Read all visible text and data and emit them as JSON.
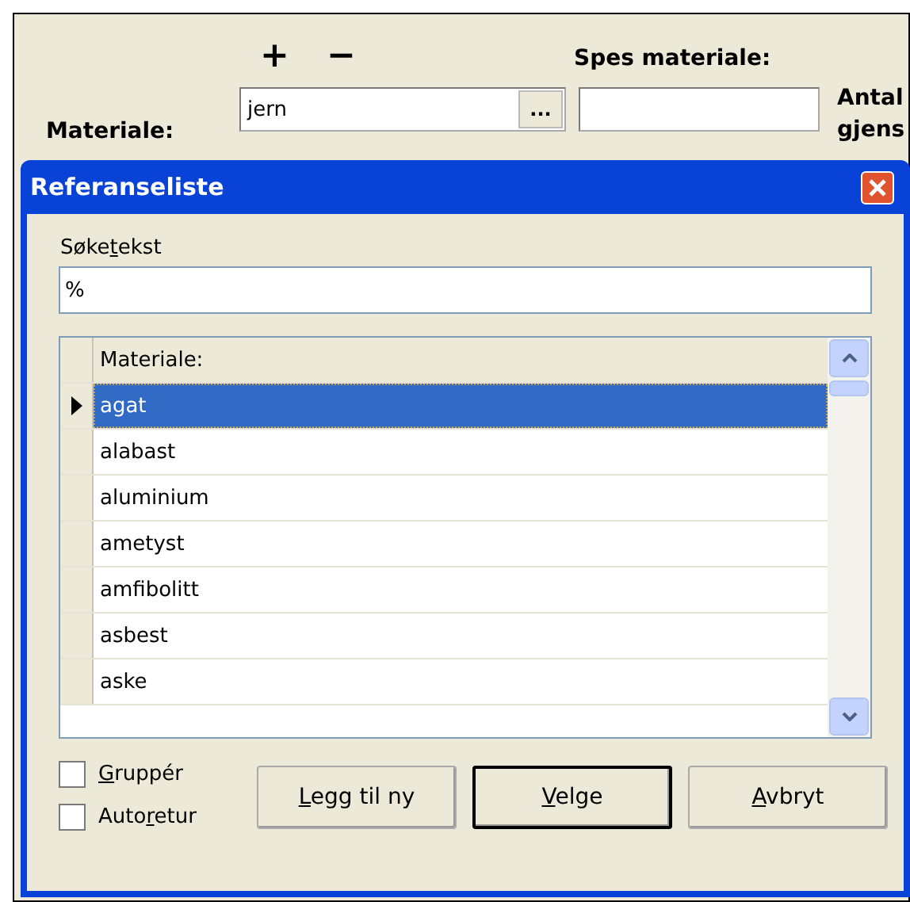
{
  "main_form": {
    "add_symbol": "+",
    "remove_symbol": "−",
    "material_label": "Materiale:",
    "material_value": "jern",
    "browse_button": "...",
    "spec_label": "Spes materiale:",
    "cut_label_lines": [
      "Antal",
      "gjens"
    ]
  },
  "dialog": {
    "title": "Referanseliste",
    "search": {
      "label": {
        "before": "Søke",
        "key": "t",
        "after": "ekst"
      },
      "value": "%"
    },
    "grid": {
      "column": "Materiale:",
      "rows": [
        {
          "name": "agat",
          "selected": true
        },
        {
          "name": "alabast",
          "selected": false
        },
        {
          "name": "aluminium",
          "selected": false
        },
        {
          "name": "ametyst",
          "selected": false
        },
        {
          "name": "amfibolitt",
          "selected": false
        },
        {
          "name": "asbest",
          "selected": false
        },
        {
          "name": "aske",
          "selected": false
        }
      ]
    },
    "checkboxes": [
      {
        "label": {
          "key": "G",
          "after": "ruppér"
        },
        "checked": false
      },
      {
        "label": {
          "before": "Auto",
          "key": "r",
          "after": "etur"
        },
        "checked": false
      }
    ],
    "buttons": [
      {
        "label": {
          "key": "L",
          "after": "egg til ny"
        },
        "default": false
      },
      {
        "label": {
          "key": "V",
          "after": "elge"
        },
        "default": true
      },
      {
        "label": {
          "key": "A",
          "after": "vbryt"
        },
        "default": false
      }
    ]
  }
}
